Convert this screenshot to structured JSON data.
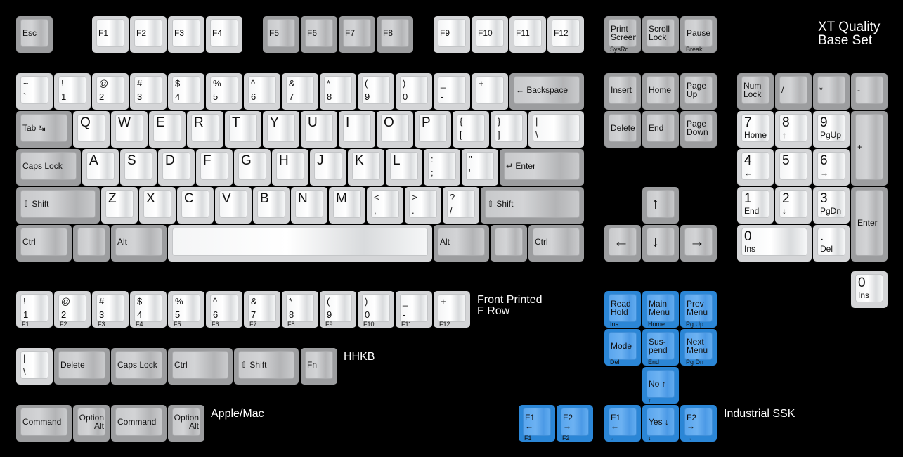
{
  "title": "XT Quality\nBase Set",
  "section_labels": {
    "front_printed": "Front Printed\nF Row",
    "hhkb": "HHKB",
    "apple": "Apple/Mac",
    "industrial": "Industrial SSK"
  },
  "colors": {
    "alpha": "#d4d5d7",
    "modifier": "#9c9d9f",
    "industrial_blue": "#2b86d6",
    "background": "#000000"
  },
  "keys": {
    "function_row": [
      {
        "id": "esc",
        "label": "Esc",
        "style": "mod"
      },
      {
        "id": "f1",
        "label": "F1",
        "style": "alpha"
      },
      {
        "id": "f2",
        "label": "F2",
        "style": "alpha"
      },
      {
        "id": "f3",
        "label": "F3",
        "style": "alpha"
      },
      {
        "id": "f4",
        "label": "F4",
        "style": "alpha"
      },
      {
        "id": "f5",
        "label": "F5",
        "style": "mod"
      },
      {
        "id": "f6",
        "label": "F6",
        "style": "mod"
      },
      {
        "id": "f7",
        "label": "F7",
        "style": "mod"
      },
      {
        "id": "f8",
        "label": "F8",
        "style": "mod"
      },
      {
        "id": "f9",
        "label": "F9",
        "style": "alpha"
      },
      {
        "id": "f10",
        "label": "F10",
        "style": "alpha"
      },
      {
        "id": "f11",
        "label": "F11",
        "style": "alpha"
      },
      {
        "id": "f12",
        "label": "F12",
        "style": "alpha"
      },
      {
        "id": "print-screen",
        "label": "Print\nScreen",
        "front": "SysRq",
        "style": "mod"
      },
      {
        "id": "scroll-lock",
        "label": "Scroll\nLock",
        "style": "mod"
      },
      {
        "id": "pause",
        "label": "Pause",
        "front": "Break",
        "style": "mod"
      }
    ],
    "number_row": [
      {
        "id": "grave",
        "top": "~",
        "bottom": "`"
      },
      {
        "id": "1",
        "top": "!",
        "bottom": "1"
      },
      {
        "id": "2",
        "top": "@",
        "bottom": "2"
      },
      {
        "id": "3",
        "top": "#",
        "bottom": "3"
      },
      {
        "id": "4",
        "top": "$",
        "bottom": "4"
      },
      {
        "id": "5",
        "top": "%",
        "bottom": "5"
      },
      {
        "id": "6",
        "top": "^",
        "bottom": "6"
      },
      {
        "id": "7",
        "top": "&",
        "bottom": "7"
      },
      {
        "id": "8",
        "top": "*",
        "bottom": "8"
      },
      {
        "id": "9",
        "top": "(",
        "bottom": "9"
      },
      {
        "id": "0",
        "top": ")",
        "bottom": "0"
      },
      {
        "id": "minus",
        "top": "_",
        "bottom": "-"
      },
      {
        "id": "equals",
        "top": "+",
        "bottom": "="
      },
      {
        "id": "backspace",
        "label": "← Backspace",
        "style": "mod"
      }
    ],
    "top_row": [
      {
        "id": "tab",
        "label": "Tab ↹",
        "style": "mod"
      },
      {
        "id": "q",
        "letter": "Q"
      },
      {
        "id": "w",
        "letter": "W"
      },
      {
        "id": "e",
        "letter": "E"
      },
      {
        "id": "r",
        "letter": "R"
      },
      {
        "id": "t",
        "letter": "T"
      },
      {
        "id": "y",
        "letter": "Y"
      },
      {
        "id": "u",
        "letter": "U"
      },
      {
        "id": "i",
        "letter": "I"
      },
      {
        "id": "o",
        "letter": "O"
      },
      {
        "id": "p",
        "letter": "P"
      },
      {
        "id": "lbracket",
        "top": "{",
        "bottom": "["
      },
      {
        "id": "rbracket",
        "top": "}",
        "bottom": "]"
      },
      {
        "id": "backslash",
        "top": "|",
        "bottom": "\\"
      }
    ],
    "home_row": [
      {
        "id": "caps-lock",
        "label": "Caps Lock",
        "style": "mod"
      },
      {
        "id": "a",
        "letter": "A"
      },
      {
        "id": "s",
        "letter": "S"
      },
      {
        "id": "d",
        "letter": "D"
      },
      {
        "id": "f",
        "letter": "F"
      },
      {
        "id": "g",
        "letter": "G"
      },
      {
        "id": "h",
        "letter": "H"
      },
      {
        "id": "j",
        "letter": "J"
      },
      {
        "id": "k",
        "letter": "K"
      },
      {
        "id": "l",
        "letter": "L"
      },
      {
        "id": "semicolon",
        "top": ":",
        "bottom": ";"
      },
      {
        "id": "quote",
        "top": "\"",
        "bottom": "'"
      },
      {
        "id": "enter",
        "label": "↵ Enter",
        "style": "mod"
      }
    ],
    "shift_row": [
      {
        "id": "left-shift",
        "label": "⇧ Shift",
        "style": "mod"
      },
      {
        "id": "z",
        "letter": "Z"
      },
      {
        "id": "x",
        "letter": "X"
      },
      {
        "id": "c",
        "letter": "C"
      },
      {
        "id": "v",
        "letter": "V"
      },
      {
        "id": "b",
        "letter": "B"
      },
      {
        "id": "n",
        "letter": "N"
      },
      {
        "id": "m",
        "letter": "M"
      },
      {
        "id": "comma",
        "top": "<",
        "bottom": ","
      },
      {
        "id": "period",
        "top": ">",
        "bottom": "."
      },
      {
        "id": "slash",
        "top": "?",
        "bottom": "/"
      },
      {
        "id": "right-shift",
        "label": "⇧ Shift",
        "style": "mod"
      }
    ],
    "bottom_row": [
      {
        "id": "left-ctrl",
        "label": "Ctrl",
        "style": "mod"
      },
      {
        "id": "left-blank",
        "label": "",
        "style": "mod"
      },
      {
        "id": "left-alt",
        "label": "Alt",
        "style": "mod"
      },
      {
        "id": "space",
        "label": "",
        "style": "alpha"
      },
      {
        "id": "right-alt",
        "label": "Alt",
        "style": "mod"
      },
      {
        "id": "right-blank",
        "label": "",
        "style": "mod"
      },
      {
        "id": "right-ctrl",
        "label": "Ctrl",
        "style": "mod"
      }
    ],
    "nav_cluster": [
      {
        "id": "insert",
        "label": "Insert"
      },
      {
        "id": "home",
        "label": "Home"
      },
      {
        "id": "page-up",
        "label": "Page\nUp"
      },
      {
        "id": "delete",
        "label": "Delete"
      },
      {
        "id": "end",
        "label": "End"
      },
      {
        "id": "page-down",
        "label": "Page\nDown"
      }
    ],
    "arrows": [
      {
        "id": "up",
        "label": "↑"
      },
      {
        "id": "left",
        "label": "←"
      },
      {
        "id": "down",
        "label": "↓"
      },
      {
        "id": "right",
        "label": "→"
      }
    ],
    "numpad": [
      {
        "id": "num-lock",
        "label": "Num\nLock",
        "style": "mod"
      },
      {
        "id": "kp-divide",
        "label": "/",
        "style": "mod"
      },
      {
        "id": "kp-multiply",
        "label": "*",
        "style": "mod"
      },
      {
        "id": "kp-minus",
        "label": "-",
        "style": "mod"
      },
      {
        "id": "kp-7",
        "num": "7",
        "sub": "Home"
      },
      {
        "id": "kp-8",
        "num": "8",
        "sub": "↑"
      },
      {
        "id": "kp-9",
        "num": "9",
        "sub": "PgUp"
      },
      {
        "id": "kp-plus",
        "label": "+",
        "style": "mod"
      },
      {
        "id": "kp-4",
        "num": "4",
        "sub": "←"
      },
      {
        "id": "kp-5",
        "num": "5",
        "sub": ""
      },
      {
        "id": "kp-6",
        "num": "6",
        "sub": "→"
      },
      {
        "id": "kp-1",
        "num": "1",
        "sub": "End"
      },
      {
        "id": "kp-2",
        "num": "2",
        "sub": "↓"
      },
      {
        "id": "kp-3",
        "num": "3",
        "sub": "PgDn"
      },
      {
        "id": "kp-enter",
        "label": "Enter",
        "style": "mod"
      },
      {
        "id": "kp-0",
        "num": "0",
        "sub": "Ins"
      },
      {
        "id": "kp-decimal",
        "num": ".",
        "sub": "Del"
      },
      {
        "id": "kp-0-alt",
        "num": "0",
        "sub": "Ins"
      }
    ],
    "front_printed_row": [
      {
        "id": "fp-1",
        "top": "!",
        "bottom": "1",
        "front": "F1"
      },
      {
        "id": "fp-2",
        "top": "@",
        "bottom": "2",
        "front": "F2"
      },
      {
        "id": "fp-3",
        "top": "#",
        "bottom": "3",
        "front": "F3"
      },
      {
        "id": "fp-4",
        "top": "$",
        "bottom": "4",
        "front": "F4"
      },
      {
        "id": "fp-5",
        "top": "%",
        "bottom": "5",
        "front": "F5"
      },
      {
        "id": "fp-6",
        "top": "^",
        "bottom": "6",
        "front": "F6"
      },
      {
        "id": "fp-7",
        "top": "&",
        "bottom": "7",
        "front": "F7"
      },
      {
        "id": "fp-8",
        "top": "*",
        "bottom": "8",
        "front": "F8"
      },
      {
        "id": "fp-9",
        "top": "(",
        "bottom": "9",
        "front": "F9"
      },
      {
        "id": "fp-0",
        "top": ")",
        "bottom": "0",
        "front": "F10"
      },
      {
        "id": "fp-minus",
        "top": "_",
        "bottom": "-",
        "front": "F11"
      },
      {
        "id": "fp-equals",
        "top": "+",
        "bottom": "=",
        "front": "F12"
      }
    ],
    "hhkb_row": [
      {
        "id": "hhkb-backslash",
        "top": "|",
        "bottom": "\\",
        "style": "alpha"
      },
      {
        "id": "hhkb-delete",
        "label": "Delete",
        "style": "mod"
      },
      {
        "id": "hhkb-caps-lock",
        "label": "Caps Lock",
        "style": "mod"
      },
      {
        "id": "hhkb-ctrl",
        "label": "Ctrl",
        "style": "mod"
      },
      {
        "id": "hhkb-shift",
        "label": "⇧ Shift",
        "style": "mod"
      },
      {
        "id": "hhkb-fn",
        "label": "Fn",
        "style": "mod"
      }
    ],
    "apple_row": [
      {
        "id": "command-1",
        "label": "Command"
      },
      {
        "id": "option-1",
        "label": "Option\nAlt",
        "align": "right"
      },
      {
        "id": "command-2",
        "label": "Command"
      },
      {
        "id": "option-2",
        "label": "Option\nAlt",
        "align": "right"
      }
    ],
    "industrial": [
      {
        "id": "read-hold",
        "label": "Read\nHold",
        "front": "Ins"
      },
      {
        "id": "main-menu",
        "label": "Main\nMenu",
        "front": "Home"
      },
      {
        "id": "prev-menu",
        "label": "Prev\nMenu",
        "front": "Pg Up"
      },
      {
        "id": "mode",
        "label": "Mode",
        "front": "Del"
      },
      {
        "id": "suspend",
        "label": "Sus-\npend",
        "front": "End"
      },
      {
        "id": "next-menu",
        "label": "Next\nMenu",
        "front": "Pg Dn"
      },
      {
        "id": "no",
        "label": "No  ↑",
        "front": "↑"
      },
      {
        "id": "ind-f1a",
        "label": "F1\n←",
        "front": "F1"
      },
      {
        "id": "ind-f2a",
        "label": "F2\n→",
        "front": "F2"
      },
      {
        "id": "ind-f1b",
        "label": "F1\n←",
        "front": "←"
      },
      {
        "id": "yes",
        "label": "Yes ↓",
        "front": "↓"
      },
      {
        "id": "ind-f2b",
        "label": "F2\n→",
        "front": "→"
      }
    ]
  }
}
